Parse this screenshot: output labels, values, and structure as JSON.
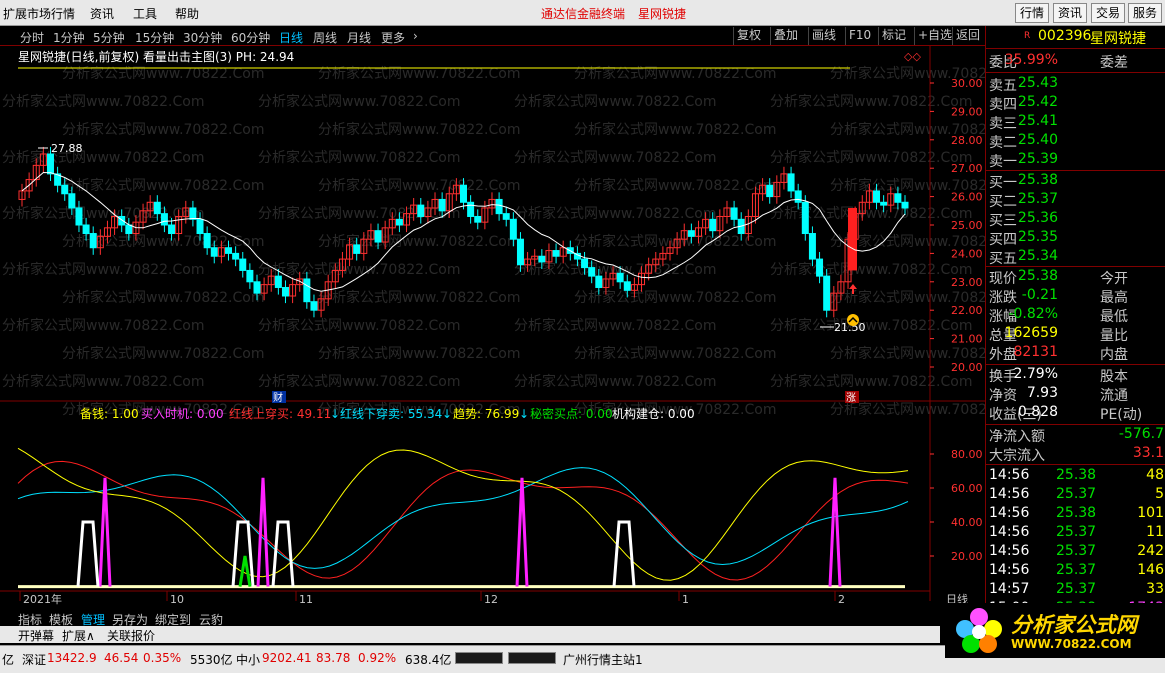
{
  "menubar": {
    "items": [
      "扩展市场行情",
      "资讯",
      "工具",
      "帮助"
    ],
    "center_items": [
      "通达信金融终端",
      "星网锐捷"
    ],
    "right_buttons": [
      "行情",
      "资讯",
      "交易",
      "服务"
    ]
  },
  "periods": [
    "分时",
    "1分钟",
    "5分钟",
    "15分钟",
    "30分钟",
    "60分钟",
    "日线",
    "周线",
    "月线",
    "更多"
  ],
  "active_period": "日线",
  "toolbar_right": [
    "复权",
    "叠加",
    "画线",
    "F10",
    "标记",
    "+自选",
    "返回"
  ],
  "chart_title": "星网锐捷(日线,前复权) 看量出击主图(3) PH: 24.94",
  "price_axis": [
    "30.00",
    "29.00",
    "28.00",
    "27.00",
    "26.00",
    "25.00",
    "24.00",
    "23.00",
    "22.00",
    "21.00",
    "20.00"
  ],
  "high_marker": "27.88",
  "low_marker": "21.50",
  "cai_label": "财",
  "zhang_label": "涨",
  "indicator_legend": {
    "beiqian": "备钱: 1.00",
    "mairu": "买入时机: 0.00",
    "hongshang": "红线上穿买: 49.11",
    "hongxia": "红线下穿卖: 55.34",
    "qushi": "趋势: 76.99",
    "mimi": "秘密买点: 0.00",
    "jigou": "机构建仓: 0.00"
  },
  "indicator_axis": [
    "80.00",
    "60.00",
    "40.00",
    "20.00"
  ],
  "date_axis": [
    "2021年",
    "10",
    "11",
    "12",
    "1",
    "2"
  ],
  "date_axis_right": "日线",
  "watermark": "分析家公式网www.70822.Com",
  "quote": {
    "badge": "R",
    "code": "002396",
    "name": "星网锐捷",
    "weibi_label": "委比",
    "weibi": "35.99%",
    "weicha_label": "委差",
    "sells": [
      {
        "label": "卖五",
        "price": "25.43"
      },
      {
        "label": "卖四",
        "price": "25.42"
      },
      {
        "label": "卖三",
        "price": "25.41"
      },
      {
        "label": "卖二",
        "price": "25.40"
      },
      {
        "label": "卖一",
        "price": "25.39"
      }
    ],
    "buys": [
      {
        "label": "买一",
        "price": "25.38"
      },
      {
        "label": "买二",
        "price": "25.37"
      },
      {
        "label": "买三",
        "price": "25.36"
      },
      {
        "label": "买四",
        "price": "25.35"
      },
      {
        "label": "买五",
        "price": "25.34"
      }
    ],
    "stats": [
      {
        "label": "现价",
        "value": "25.38",
        "label2": "今开",
        "cls": "green"
      },
      {
        "label": "涨跌",
        "value": "-0.21",
        "label2": "最高",
        "cls": "green"
      },
      {
        "label": "涨幅",
        "value": "-0.82%",
        "label2": "最低",
        "cls": "green"
      },
      {
        "label": "总量",
        "value": "162659",
        "label2": "量比",
        "cls": "yellow"
      },
      {
        "label": "外盘",
        "value": "82131",
        "label2": "内盘",
        "cls": "red"
      }
    ],
    "stats2": [
      {
        "label": "换手",
        "value": "2.79%",
        "label2": "股本"
      },
      {
        "label": "净资",
        "value": "7.93",
        "label2": "流通"
      },
      {
        "label": "收益(三)",
        "value": "0.828",
        "label2": "PE(动)"
      }
    ],
    "flow": [
      {
        "label": "净流入额",
        "value": "-576.7",
        "cls": "green"
      },
      {
        "label": "大宗流入",
        "value": "33.1",
        "cls": "red"
      }
    ],
    "ticks": [
      {
        "time": "14:56",
        "price": "25.38",
        "vol": "48",
        "cls": "yellow"
      },
      {
        "time": "14:56",
        "price": "25.37",
        "vol": "5",
        "cls": "yellow"
      },
      {
        "time": "14:56",
        "price": "25.38",
        "vol": "101",
        "cls": "yellow"
      },
      {
        "time": "14:56",
        "price": "25.37",
        "vol": "11",
        "cls": "yellow"
      },
      {
        "time": "14:56",
        "price": "25.37",
        "vol": "242",
        "cls": "yellow"
      },
      {
        "time": "14:56",
        "price": "25.37",
        "vol": "146",
        "cls": "yellow"
      },
      {
        "time": "14:57",
        "price": "25.37",
        "vol": "33",
        "cls": "yellow"
      },
      {
        "time": "15:00",
        "price": "25.38",
        "vol": "1743",
        "cls": "magenta"
      }
    ]
  },
  "tabs1": [
    "指标",
    "模板",
    "管理",
    "另存为",
    "绑定到",
    "云豹"
  ],
  "tabs2": [
    "开弹幕",
    "扩展∧",
    "关联报价"
  ],
  "status": {
    "yi": "亿",
    "sz_label": "深证",
    "sz_value": "13422.9",
    "sz_change": "46.54",
    "sz_pct": "0.35%",
    "sz_amount": "5530亿",
    "zx_label": "中小",
    "zx_value": "9202.41",
    "zx_change": "83.78",
    "zx_pct": "0.92%",
    "zx_amount": "638.4亿",
    "server": "广州行情主站1"
  },
  "logo": {
    "text": "分析家公式网",
    "url": "WWW.70822.COM"
  }
}
